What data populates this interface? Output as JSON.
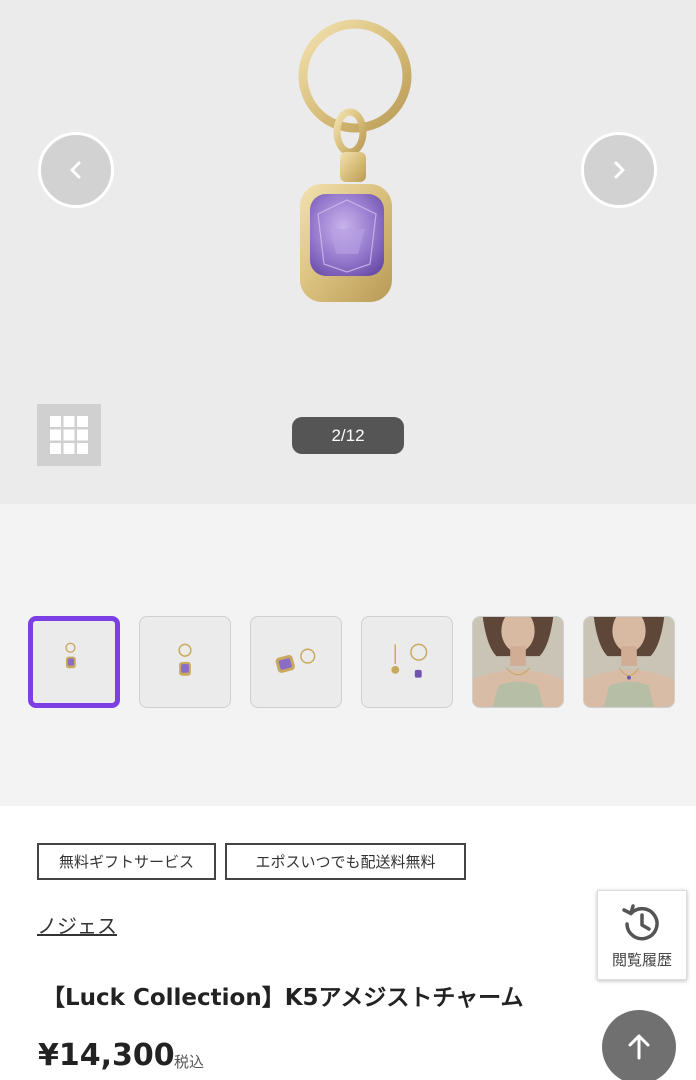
{
  "gallery": {
    "counter": "2/12",
    "current_index": 2,
    "total": 12,
    "icons": {
      "prev": "chevron-left-icon",
      "next": "chevron-right-icon",
      "grid": "grid-icon"
    }
  },
  "thumbnails": [
    {
      "name": "thumb-charm-front",
      "selected": true
    },
    {
      "name": "thumb-charm-angle",
      "selected": false
    },
    {
      "name": "thumb-charm-side",
      "selected": false
    },
    {
      "name": "thumb-earrings-pair",
      "selected": false
    },
    {
      "name": "thumb-model-necklace-1",
      "selected": false
    },
    {
      "name": "thumb-model-necklace-2",
      "selected": false
    }
  ],
  "tags": [
    "無料ギフトサービス",
    "エポスいつでも配送料無料"
  ],
  "brand": "ノジェス",
  "product": {
    "title": "【Luck Collection】K5アメジストチャーム",
    "price": "¥14,300",
    "tax_label": "税込"
  },
  "history": {
    "label": "閲覧履歴",
    "icon": "history-icon"
  },
  "back_to_top": {
    "icon": "arrow-up-icon"
  },
  "colors": {
    "selected_border": "#7b3fe4",
    "gallery_bg": "#ebebeb",
    "counter_bg": "#555555"
  }
}
